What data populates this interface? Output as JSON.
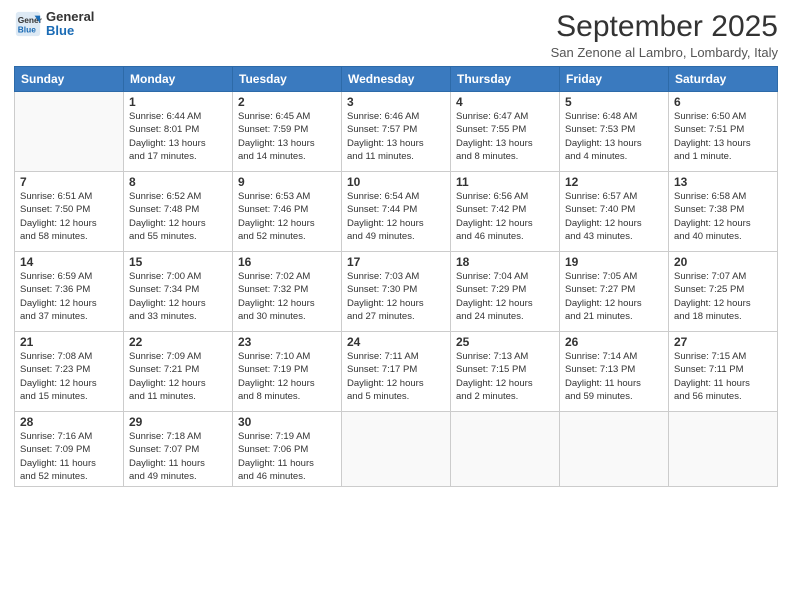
{
  "logo": {
    "line1": "General",
    "line2": "Blue"
  },
  "title": "September 2025",
  "subtitle": "San Zenone al Lambro, Lombardy, Italy",
  "days_of_week": [
    "Sunday",
    "Monday",
    "Tuesday",
    "Wednesday",
    "Thursday",
    "Friday",
    "Saturday"
  ],
  "weeks": [
    [
      {
        "day": "",
        "info": ""
      },
      {
        "day": "1",
        "info": "Sunrise: 6:44 AM\nSunset: 8:01 PM\nDaylight: 13 hours\nand 17 minutes."
      },
      {
        "day": "2",
        "info": "Sunrise: 6:45 AM\nSunset: 7:59 PM\nDaylight: 13 hours\nand 14 minutes."
      },
      {
        "day": "3",
        "info": "Sunrise: 6:46 AM\nSunset: 7:57 PM\nDaylight: 13 hours\nand 11 minutes."
      },
      {
        "day": "4",
        "info": "Sunrise: 6:47 AM\nSunset: 7:55 PM\nDaylight: 13 hours\nand 8 minutes."
      },
      {
        "day": "5",
        "info": "Sunrise: 6:48 AM\nSunset: 7:53 PM\nDaylight: 13 hours\nand 4 minutes."
      },
      {
        "day": "6",
        "info": "Sunrise: 6:50 AM\nSunset: 7:51 PM\nDaylight: 13 hours\nand 1 minute."
      }
    ],
    [
      {
        "day": "7",
        "info": "Sunrise: 6:51 AM\nSunset: 7:50 PM\nDaylight: 12 hours\nand 58 minutes."
      },
      {
        "day": "8",
        "info": "Sunrise: 6:52 AM\nSunset: 7:48 PM\nDaylight: 12 hours\nand 55 minutes."
      },
      {
        "day": "9",
        "info": "Sunrise: 6:53 AM\nSunset: 7:46 PM\nDaylight: 12 hours\nand 52 minutes."
      },
      {
        "day": "10",
        "info": "Sunrise: 6:54 AM\nSunset: 7:44 PM\nDaylight: 12 hours\nand 49 minutes."
      },
      {
        "day": "11",
        "info": "Sunrise: 6:56 AM\nSunset: 7:42 PM\nDaylight: 12 hours\nand 46 minutes."
      },
      {
        "day": "12",
        "info": "Sunrise: 6:57 AM\nSunset: 7:40 PM\nDaylight: 12 hours\nand 43 minutes."
      },
      {
        "day": "13",
        "info": "Sunrise: 6:58 AM\nSunset: 7:38 PM\nDaylight: 12 hours\nand 40 minutes."
      }
    ],
    [
      {
        "day": "14",
        "info": "Sunrise: 6:59 AM\nSunset: 7:36 PM\nDaylight: 12 hours\nand 37 minutes."
      },
      {
        "day": "15",
        "info": "Sunrise: 7:00 AM\nSunset: 7:34 PM\nDaylight: 12 hours\nand 33 minutes."
      },
      {
        "day": "16",
        "info": "Sunrise: 7:02 AM\nSunset: 7:32 PM\nDaylight: 12 hours\nand 30 minutes."
      },
      {
        "day": "17",
        "info": "Sunrise: 7:03 AM\nSunset: 7:30 PM\nDaylight: 12 hours\nand 27 minutes."
      },
      {
        "day": "18",
        "info": "Sunrise: 7:04 AM\nSunset: 7:29 PM\nDaylight: 12 hours\nand 24 minutes."
      },
      {
        "day": "19",
        "info": "Sunrise: 7:05 AM\nSunset: 7:27 PM\nDaylight: 12 hours\nand 21 minutes."
      },
      {
        "day": "20",
        "info": "Sunrise: 7:07 AM\nSunset: 7:25 PM\nDaylight: 12 hours\nand 18 minutes."
      }
    ],
    [
      {
        "day": "21",
        "info": "Sunrise: 7:08 AM\nSunset: 7:23 PM\nDaylight: 12 hours\nand 15 minutes."
      },
      {
        "day": "22",
        "info": "Sunrise: 7:09 AM\nSunset: 7:21 PM\nDaylight: 12 hours\nand 11 minutes."
      },
      {
        "day": "23",
        "info": "Sunrise: 7:10 AM\nSunset: 7:19 PM\nDaylight: 12 hours\nand 8 minutes."
      },
      {
        "day": "24",
        "info": "Sunrise: 7:11 AM\nSunset: 7:17 PM\nDaylight: 12 hours\nand 5 minutes."
      },
      {
        "day": "25",
        "info": "Sunrise: 7:13 AM\nSunset: 7:15 PM\nDaylight: 12 hours\nand 2 minutes."
      },
      {
        "day": "26",
        "info": "Sunrise: 7:14 AM\nSunset: 7:13 PM\nDaylight: 11 hours\nand 59 minutes."
      },
      {
        "day": "27",
        "info": "Sunrise: 7:15 AM\nSunset: 7:11 PM\nDaylight: 11 hours\nand 56 minutes."
      }
    ],
    [
      {
        "day": "28",
        "info": "Sunrise: 7:16 AM\nSunset: 7:09 PM\nDaylight: 11 hours\nand 52 minutes."
      },
      {
        "day": "29",
        "info": "Sunrise: 7:18 AM\nSunset: 7:07 PM\nDaylight: 11 hours\nand 49 minutes."
      },
      {
        "day": "30",
        "info": "Sunrise: 7:19 AM\nSunset: 7:06 PM\nDaylight: 11 hours\nand 46 minutes."
      },
      {
        "day": "",
        "info": ""
      },
      {
        "day": "",
        "info": ""
      },
      {
        "day": "",
        "info": ""
      },
      {
        "day": "",
        "info": ""
      }
    ]
  ]
}
